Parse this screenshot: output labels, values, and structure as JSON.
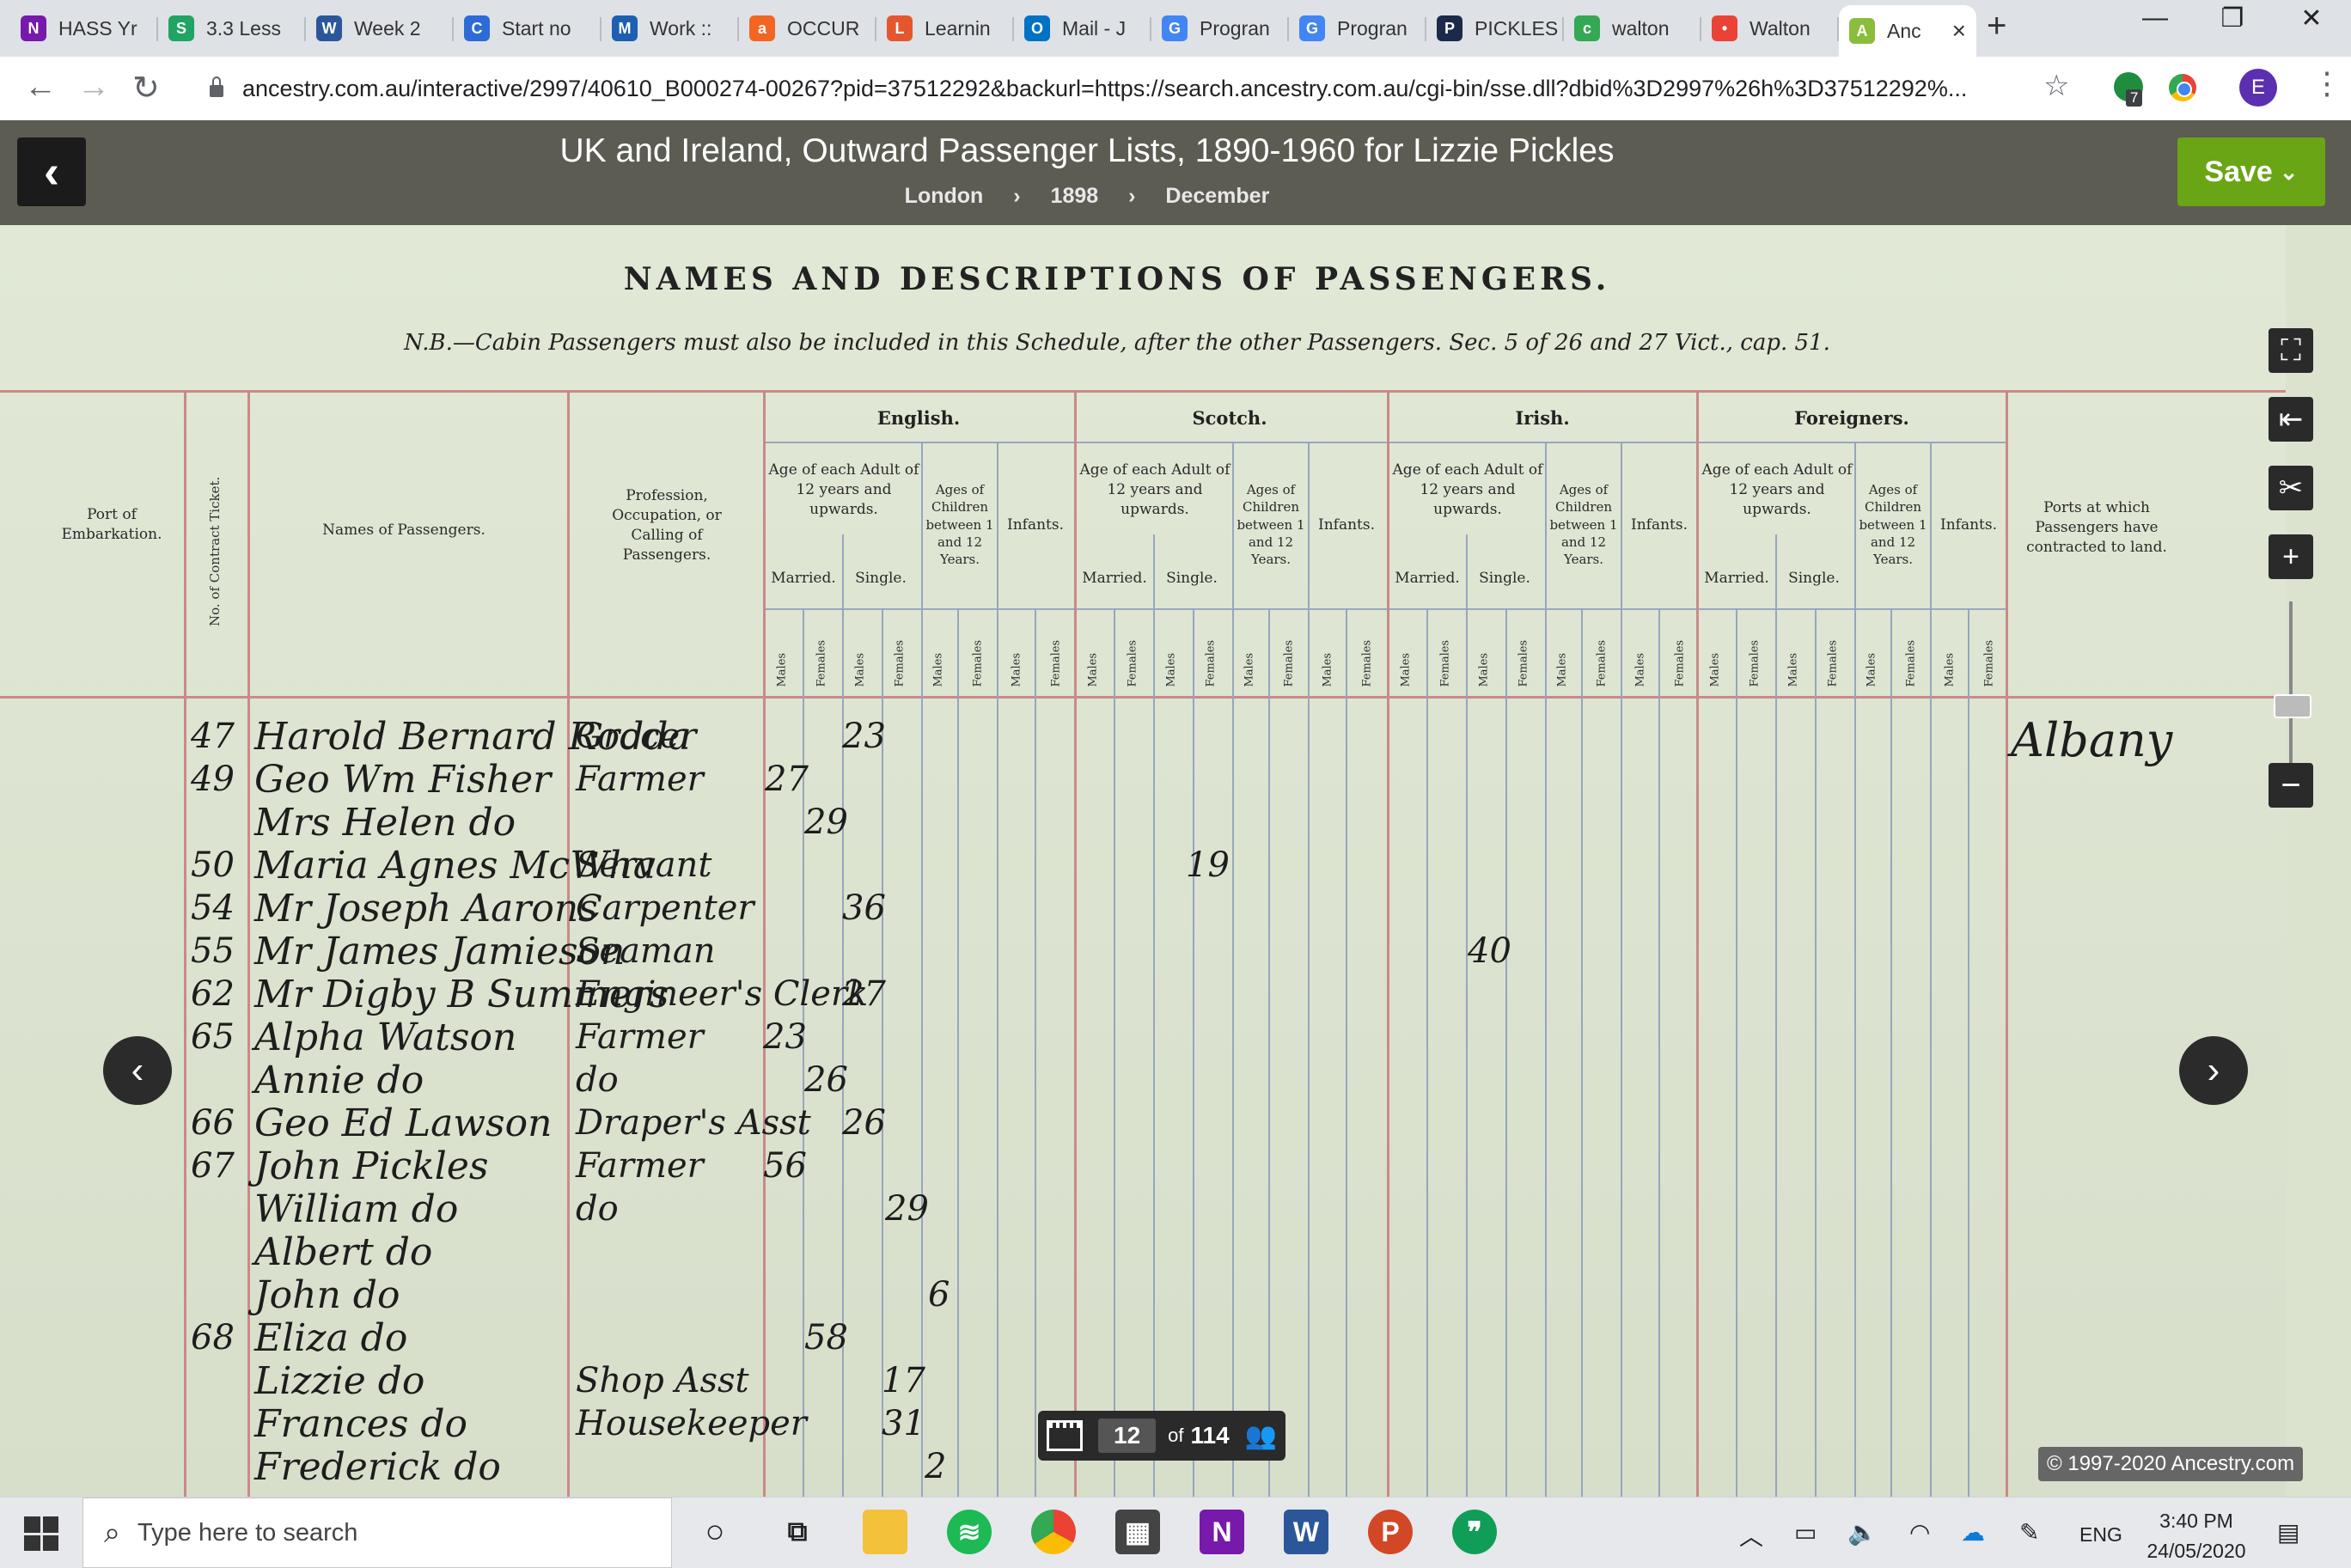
{
  "browser": {
    "tabs": [
      {
        "label": "HASS Yr",
        "icon": "onenote-icon",
        "color": "#7719aa",
        "glyph": "N"
      },
      {
        "label": "3.3 Less",
        "icon": "sheets-s-icon",
        "color": "#1fa463",
        "glyph": "S"
      },
      {
        "label": "Week 2",
        "icon": "word-icon",
        "color": "#2b579a",
        "glyph": "W"
      },
      {
        "label": "Start no",
        "icon": "circle-c-icon",
        "color": "#2d6bd6",
        "glyph": "C"
      },
      {
        "label": "Work ::",
        "icon": "m-logo-icon",
        "color": "#1d5fb0",
        "glyph": "M"
      },
      {
        "label": "OCCUR",
        "icon": "a-logo-icon",
        "color": "#f26522",
        "glyph": "a"
      },
      {
        "label": "Learnin",
        "icon": "learning-icon",
        "color": "#e4572e",
        "glyph": "L"
      },
      {
        "label": "Mail - J",
        "icon": "outlook-icon",
        "color": "#0072c6",
        "glyph": "O"
      },
      {
        "label": "Progran",
        "icon": "google-g-icon",
        "color": "#4285f4",
        "glyph": "G"
      },
      {
        "label": "Progran",
        "icon": "google-g-icon",
        "color": "#4285f4",
        "glyph": "G"
      },
      {
        "label": "PICKLES",
        "icon": "pickles-icon",
        "color": "#1b2a4a",
        "glyph": "P"
      },
      {
        "label": "walton",
        "icon": "chrome-icon",
        "color": "#34a853",
        "glyph": "c"
      },
      {
        "label": "Walton",
        "icon": "maps-pin-icon",
        "color": "#ea4335",
        "glyph": "•"
      },
      {
        "label": "Anc",
        "icon": "ancestry-leaf-icon",
        "color": "#8bbd3c",
        "glyph": "A",
        "active": true
      }
    ],
    "new_tab": "+",
    "url": "ancestry.com.au/interactive/2997/40610_B000274-00267?pid=37512292&backurl=https://search.ancestry.com.au/cgi-bin/sse.dll?dbid%3D2997%26h%3D37512292%...",
    "extension_badge": "7",
    "profile_initial": "E"
  },
  "header": {
    "title": "UK and Ireland, Outward Passenger Lists, 1890-1960 for Lizzie Pickles",
    "breadcrumbs": [
      "London",
      "1898",
      "December"
    ],
    "breadcrumb_sep": "›",
    "save_label": "Save"
  },
  "document": {
    "heading": "NAMES AND DESCRIPTIONS OF PASSENGERS.",
    "note": "N.B.—Cabin Passengers must also be included in this Schedule, after the other Passengers.   Sec. 5 of 26 and 27 Vict., cap. 51.",
    "col_port": "Port of Embarkation.",
    "col_ticket": "No. of Contract Ticket.",
    "col_names": "Names of Passengers.",
    "col_profession": "Profession, Occupation, or Calling of Passengers.",
    "col_ports_land": "Ports at which Passengers have contracted to land.",
    "groups": [
      "English.",
      "Scotch.",
      "Irish.",
      "Foreigners."
    ],
    "age_adult": "Age of each Adult of 12 years and upwards.",
    "age_children": "Ages of Children between 1 and 12 Years.",
    "infants": "Infants.",
    "married": "Married.",
    "single": "Single.",
    "males": "Males",
    "females": "Females",
    "rows": [
      {
        "ticket": "47",
        "name": "Harold Bernard Rodda",
        "occupation": "Grocer",
        "age": "23",
        "port": "Albany"
      },
      {
        "ticket": "49",
        "name": "Geo Wm Fisher",
        "occupation": "Farmer",
        "age": "27"
      },
      {
        "ticket": "",
        "name": "Mrs Helen do",
        "occupation": "",
        "age": "29"
      },
      {
        "ticket": "50",
        "name": "Maria Agnes McWha",
        "occupation": "Servant",
        "age": "19"
      },
      {
        "ticket": "54",
        "name": "Mr Joseph Aarons",
        "occupation": "Carpenter",
        "age": "36"
      },
      {
        "ticket": "55",
        "name": "Mr James Jamieson",
        "occupation": "Seaman",
        "age": "40"
      },
      {
        "ticket": "62",
        "name": "Mr Digby B Summers",
        "occupation": "Engineer's Clerk",
        "age": "27"
      },
      {
        "ticket": "65",
        "name": "Alpha Watson",
        "occupation": "Farmer",
        "age": "23"
      },
      {
        "ticket": "",
        "name": "Annie do",
        "occupation": "do",
        "age": "26"
      },
      {
        "ticket": "66",
        "name": "Geo Ed Lawson",
        "occupation": "Draper's Asst",
        "age": "26"
      },
      {
        "ticket": "67",
        "name": "John Pickles",
        "occupation": "Farmer",
        "age": "56"
      },
      {
        "ticket": "",
        "name": "William do",
        "occupation": "do",
        "age": "29"
      },
      {
        "ticket": "",
        "name": "Albert do",
        "occupation": "",
        "age": ""
      },
      {
        "ticket": "",
        "name": "John do",
        "occupation": "",
        "age": "6"
      },
      {
        "ticket": "68",
        "name": "Eliza do",
        "occupation": "",
        "age": "58"
      },
      {
        "ticket": "",
        "name": "Lizzie do",
        "occupation": "Shop Asst",
        "age": "17"
      },
      {
        "ticket": "",
        "name": "Frances do",
        "occupation": "Housekeeper",
        "age": "31"
      },
      {
        "ticket": "",
        "name": "Frederick do",
        "occupation": "",
        "age": "2"
      }
    ]
  },
  "viewer": {
    "page_current": "12",
    "page_of": "of",
    "page_total": "114",
    "copyright": "© 1997-2020 Ancestry.com"
  },
  "taskbar": {
    "search_placeholder": "Type here to search",
    "language": "ENG",
    "time": "3:40 PM",
    "date": "24/05/2020"
  }
}
